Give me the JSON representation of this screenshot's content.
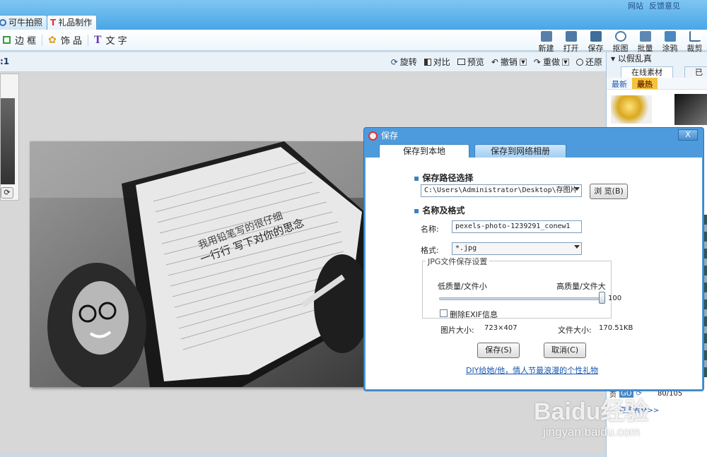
{
  "app": {
    "tabs": [
      {
        "label": "可牛拍照"
      },
      {
        "label": "礼品制作"
      }
    ],
    "top_links": [
      "网站",
      "反馈意见"
    ]
  },
  "toolbar": {
    "left": [
      {
        "label": "边 框",
        "icon": "frame-icon"
      },
      {
        "label": "饰 品",
        "icon": "clover-icon"
      },
      {
        "label": "文 字",
        "icon": "text-t-icon"
      }
    ],
    "right": [
      {
        "label": "新建",
        "icon": "new-file-icon"
      },
      {
        "label": "打开",
        "icon": "open-folder-icon"
      },
      {
        "label": "保存",
        "icon": "save-disk-icon"
      },
      {
        "label": "抠图",
        "icon": "cutout-icon"
      },
      {
        "label": "批量",
        "icon": "batch-icon"
      },
      {
        "label": "涂鸦",
        "icon": "doodle-icon"
      },
      {
        "label": "裁剪",
        "icon": "crop-icon"
      }
    ]
  },
  "subbar": {
    "zoom_fragment": ":1",
    "tools": [
      {
        "label": "旋转",
        "icon": "rotate-icon"
      },
      {
        "label": "对比",
        "icon": "compare-icon"
      },
      {
        "label": "预览",
        "icon": "preview-icon"
      },
      {
        "label": "撤销",
        "icon": "undo-icon",
        "dropdown": true
      },
      {
        "label": "重做",
        "icon": "redo-icon",
        "dropdown": true
      },
      {
        "label": "还原",
        "icon": "restore-icon"
      }
    ]
  },
  "photo": {
    "overlay_text_line1": "我用铅笔写的很仔细",
    "overlay_text_line2": "一行行 写下对你的思念"
  },
  "right_panel": {
    "header": "以假乱真",
    "tabs": [
      "在线素材",
      "已"
    ],
    "filters": [
      "最新",
      "最热"
    ],
    "active_filter": "最热",
    "pager_text": "页",
    "pager_go": "GO",
    "pager_count": "80/105",
    "link": "...更多素材>>"
  },
  "dialog": {
    "title": "保存",
    "close_label": "X",
    "tabs": [
      "保存到本地",
      "保存到网络相册"
    ],
    "path_section": "保存路径选择",
    "path_value": "C:\\Users\\Administrator\\Desktop\\存图片",
    "browse_button": "浏 览(B)",
    "name_section": "名称及格式",
    "name_label": "名称:",
    "name_value": "pexels-photo-1239291_conew1",
    "format_label": "格式:",
    "format_value": "*.jpg",
    "jpg_group_title": "JPG文件保存设置",
    "low_quality_label": "低质量/文件小",
    "high_quality_label": "高质量/文件大",
    "quality_value": "100",
    "quality_fraction": 1.0,
    "exif_label": "删除EXIF信息",
    "exif_checked": false,
    "image_size_label": "图片大小:",
    "image_size_value": "723×407",
    "file_size_label": "文件大小:",
    "file_size_value": "170.51KB",
    "save_button": "保存(S)",
    "cancel_button": "取消(C)",
    "promo_link": "DIY给她/他，情人节最浪漫的个性礼物"
  },
  "watermark": {
    "line1": "Baidu经验",
    "line2": "jingyan.baidu.com"
  },
  "colors": {
    "titlebar": "#4aa6e6",
    "dialog_frame": "#4d9bdc",
    "link": "#1a56b0",
    "hot_tag": "#f6c23a"
  }
}
